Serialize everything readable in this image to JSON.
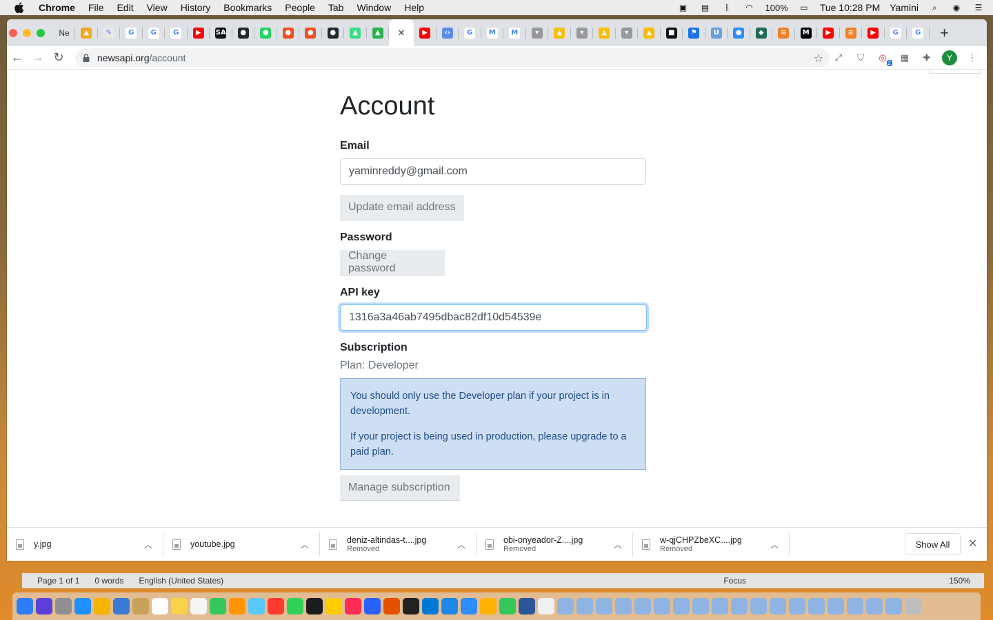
{
  "menubar": {
    "app": "Chrome",
    "items": [
      "File",
      "Edit",
      "View",
      "History",
      "Bookmarks",
      "People",
      "Tab",
      "Window",
      "Help"
    ],
    "battery": "100%",
    "clock": "Tue 10:28 PM",
    "user": "Yamini"
  },
  "browser": {
    "first_tab_label": "Ne",
    "tabs": [
      {
        "icon": "flame-icon",
        "color": "#f5a623",
        "glyph": "▲"
      },
      {
        "icon": "sheets-icon",
        "color": "#e8e8e8",
        "glyph": "✎"
      },
      {
        "icon": "google-icon",
        "color": "#ffffff",
        "glyph": "G"
      },
      {
        "icon": "google-icon",
        "color": "#ffffff",
        "glyph": "G"
      },
      {
        "icon": "google-icon",
        "color": "#ffffff",
        "glyph": "G"
      },
      {
        "icon": "youtube-icon",
        "color": "#ff0000",
        "glyph": "▶"
      },
      {
        "icon": "sa-icon",
        "color": "#111111",
        "glyph": "SA"
      },
      {
        "icon": "github-icon",
        "color": "#24292e",
        "glyph": "●"
      },
      {
        "icon": "whatsapp-icon",
        "color": "#25d366",
        "glyph": "●"
      },
      {
        "icon": "red-circle-icon",
        "color": "#f25022",
        "glyph": "●"
      },
      {
        "icon": "red-circle-icon",
        "color": "#f25022",
        "glyph": "●"
      },
      {
        "icon": "github-icon",
        "color": "#24292e",
        "glyph": "●"
      },
      {
        "icon": "android-icon",
        "color": "#3ddc84",
        "glyph": "▲"
      },
      {
        "icon": "feedly-icon",
        "color": "#2bb24c",
        "glyph": "▲"
      },
      {
        "icon": "youtube-icon",
        "color": "#ff0000",
        "glyph": "▶"
      },
      {
        "icon": "code-icon",
        "color": "#5b8def",
        "glyph": "‹›"
      },
      {
        "icon": "google-icon",
        "color": "#ffffff",
        "glyph": "G"
      },
      {
        "icon": "gmail-icon",
        "color": "#ffffff",
        "glyph": "M"
      },
      {
        "icon": "gmail-icon",
        "color": "#ffffff",
        "glyph": "M"
      },
      {
        "icon": "pocket-icon",
        "color": "#999999",
        "glyph": "▾"
      },
      {
        "icon": "drive-icon",
        "color": "#fbbc04",
        "glyph": "▲"
      },
      {
        "icon": "pocket-icon",
        "color": "#999999",
        "glyph": "▾"
      },
      {
        "icon": "drive-icon",
        "color": "#fbbc04",
        "glyph": "▲"
      },
      {
        "icon": "pocket-icon",
        "color": "#999999",
        "glyph": "▾"
      },
      {
        "icon": "drive-icon",
        "color": "#fbbc04",
        "glyph": "▲"
      },
      {
        "icon": "bookmark-icon",
        "color": "#111111",
        "glyph": "■"
      },
      {
        "icon": "people-icon",
        "color": "#1a73e8",
        "glyph": "⚑"
      },
      {
        "icon": "unc-icon",
        "color": "#6a9fd8",
        "glyph": "U"
      },
      {
        "icon": "zoom-icon",
        "color": "#2d8cff",
        "glyph": "●"
      },
      {
        "icon": "diamond-icon",
        "color": "#1d6b52",
        "glyph": "◆"
      },
      {
        "icon": "stackoverflow-icon",
        "color": "#f48024",
        "glyph": "≡"
      },
      {
        "icon": "medium-icon",
        "color": "#000000",
        "glyph": "M"
      },
      {
        "icon": "youtube-icon",
        "color": "#ff0000",
        "glyph": "▶"
      },
      {
        "icon": "stackoverflow-icon",
        "color": "#f48024",
        "glyph": "≡"
      },
      {
        "icon": "youtube-icon",
        "color": "#ff0000",
        "glyph": "▶"
      },
      {
        "icon": "google-icon",
        "color": "#ffffff",
        "glyph": "G"
      },
      {
        "icon": "google-icon",
        "color": "#ffffff",
        "glyph": "G"
      }
    ],
    "active_tab_index": 13,
    "url_host": "newsapi.org",
    "url_path": "/account",
    "profile_initial": "Y",
    "ext_badge": "2"
  },
  "account": {
    "title": "Account",
    "email_label": "Email",
    "email_value": "yaminreddy@gmail.com",
    "update_email_button": "Update email address",
    "password_label": "Password",
    "change_password_button": "Change password",
    "api_key_label": "API key",
    "api_key_value": "1316a3a46ab7495dbac82df10d54539e",
    "subscription_label": "Subscription",
    "plan_text": "Plan: Developer",
    "alert_line1": "You should only use the Developer plan if your project is in development.",
    "alert_line2": "If your project is being used in production, please upgrade to a paid plan.",
    "manage_subscription_button": "Manage subscription"
  },
  "downloads": {
    "items": [
      {
        "name": "y.jpg",
        "status": ""
      },
      {
        "name": "youtube.jpg",
        "status": ""
      },
      {
        "name": "deniz-altindas-t....jpg",
        "status": "Removed"
      },
      {
        "name": "obi-onyeador-Z....jpg",
        "status": "Removed"
      },
      {
        "name": "w-qjCHPZbeXC....jpg",
        "status": "Removed"
      }
    ],
    "show_all": "Show All"
  },
  "word_status": {
    "page": "Page 1 of 1",
    "words": "0 words",
    "language": "English (United States)",
    "focus": "Focus",
    "zoom": "150%"
  }
}
